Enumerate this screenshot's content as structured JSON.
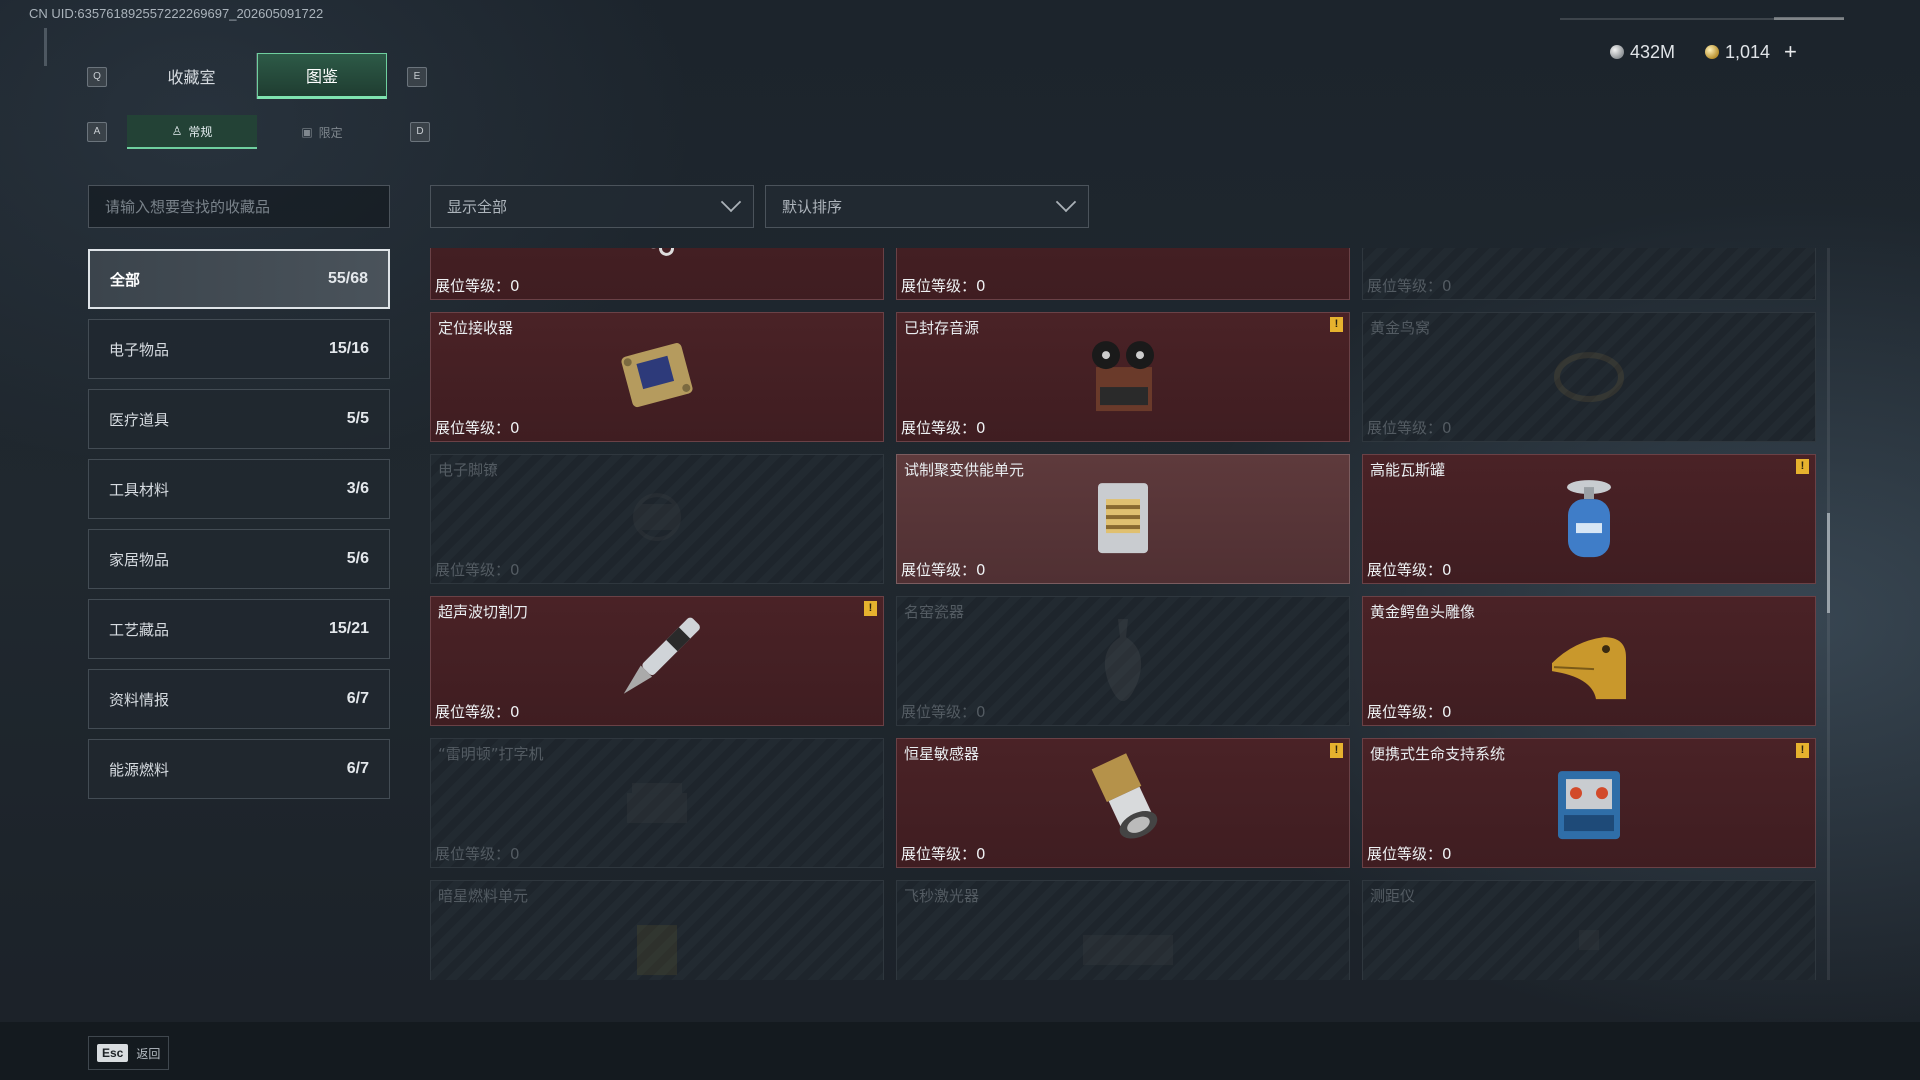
{
  "header": {
    "uid": "CN UID:635761892557222269697_202605091722",
    "currency": [
      {
        "icon": "silver-coin-icon",
        "value": "432M"
      },
      {
        "icon": "gold-coin-icon",
        "value": "1,014"
      }
    ],
    "add_symbol": "+"
  },
  "keys": {
    "q": "Q",
    "e": "E",
    "a": "A",
    "d": "D",
    "esc": "Esc"
  },
  "tabs": [
    {
      "label": "收藏室",
      "active": false
    },
    {
      "label": "图鉴",
      "active": true
    }
  ],
  "subtabs": [
    {
      "label": "常规",
      "icon": "figure-icon",
      "active": true
    },
    {
      "label": "限定",
      "icon": "image-icon",
      "active": false
    }
  ],
  "search": {
    "placeholder": "请输入想要查找的收藏品"
  },
  "filters": {
    "show": "显示全部",
    "sort": "默认排序"
  },
  "categories": [
    {
      "label": "全部",
      "count": "55/68",
      "active": true
    },
    {
      "label": "电子物品",
      "count": "15/16"
    },
    {
      "label": "医疗道具",
      "count": "5/5"
    },
    {
      "label": "工具材料",
      "count": "3/6"
    },
    {
      "label": "家居物品",
      "count": "5/6"
    },
    {
      "label": "工艺藏品",
      "count": "15/21"
    },
    {
      "label": "资料情报",
      "count": "6/7"
    },
    {
      "label": "能源燃料",
      "count": "6/7"
    }
  ],
  "cards": [
    {
      "name": "",
      "level": "展位等级：0",
      "state": "owned",
      "art": "fuel-canister",
      "warn": false
    },
    {
      "name": "",
      "level": "展位等级：0",
      "state": "owned",
      "art": "gold-card",
      "warn": false
    },
    {
      "name": "",
      "level": "展位等级：0",
      "state": "locked",
      "art": "frame",
      "warn": false
    },
    {
      "name": "定位接收器",
      "level": "展位等级：0",
      "state": "owned",
      "art": "receiver",
      "warn": false
    },
    {
      "name": "已封存音源",
      "level": "展位等级：0",
      "state": "owned",
      "art": "tape-recorder",
      "warn": true
    },
    {
      "name": "黄金鸟窝",
      "level": "展位等级：0",
      "state": "locked",
      "art": "nest",
      "warn": false
    },
    {
      "name": "电子脚镣",
      "level": "展位等级：0",
      "state": "locked",
      "art": "shackle",
      "warn": false
    },
    {
      "name": "试制聚变供能单元",
      "level": "展位等级：0",
      "state": "highlight",
      "art": "fusion-unit",
      "warn": false
    },
    {
      "name": "高能瓦斯罐",
      "level": "展位等级：0",
      "state": "owned",
      "art": "gas-canister",
      "warn": true
    },
    {
      "name": "超声波切割刀",
      "level": "展位等级：0",
      "state": "owned",
      "art": "cutter",
      "warn": true
    },
    {
      "name": "名窑瓷器",
      "level": "展位等级：0",
      "state": "locked",
      "art": "vase",
      "warn": false
    },
    {
      "name": "黄金鳄鱼头雕像",
      "level": "展位等级：0",
      "state": "owned",
      "art": "croc-head",
      "warn": false
    },
    {
      "name": "“雷明顿”打字机",
      "level": "展位等级：0",
      "state": "locked",
      "art": "typewriter",
      "warn": false
    },
    {
      "name": "恒星敏感器",
      "level": "展位等级：0",
      "state": "owned",
      "art": "star-sensor",
      "warn": true
    },
    {
      "name": "便携式生命支持系统",
      "level": "展位等级：0",
      "state": "owned",
      "art": "life-support",
      "warn": true
    },
    {
      "name": "暗星燃料单元",
      "level": "",
      "state": "locked",
      "art": "fuel-unit",
      "warn": false
    },
    {
      "name": "飞秒激光器",
      "level": "",
      "state": "locked",
      "art": "laser",
      "warn": false
    },
    {
      "name": "测距仪",
      "level": "",
      "state": "locked",
      "art": "rangefinder",
      "warn": false
    }
  ],
  "footer": {
    "back_label": "返回"
  }
}
